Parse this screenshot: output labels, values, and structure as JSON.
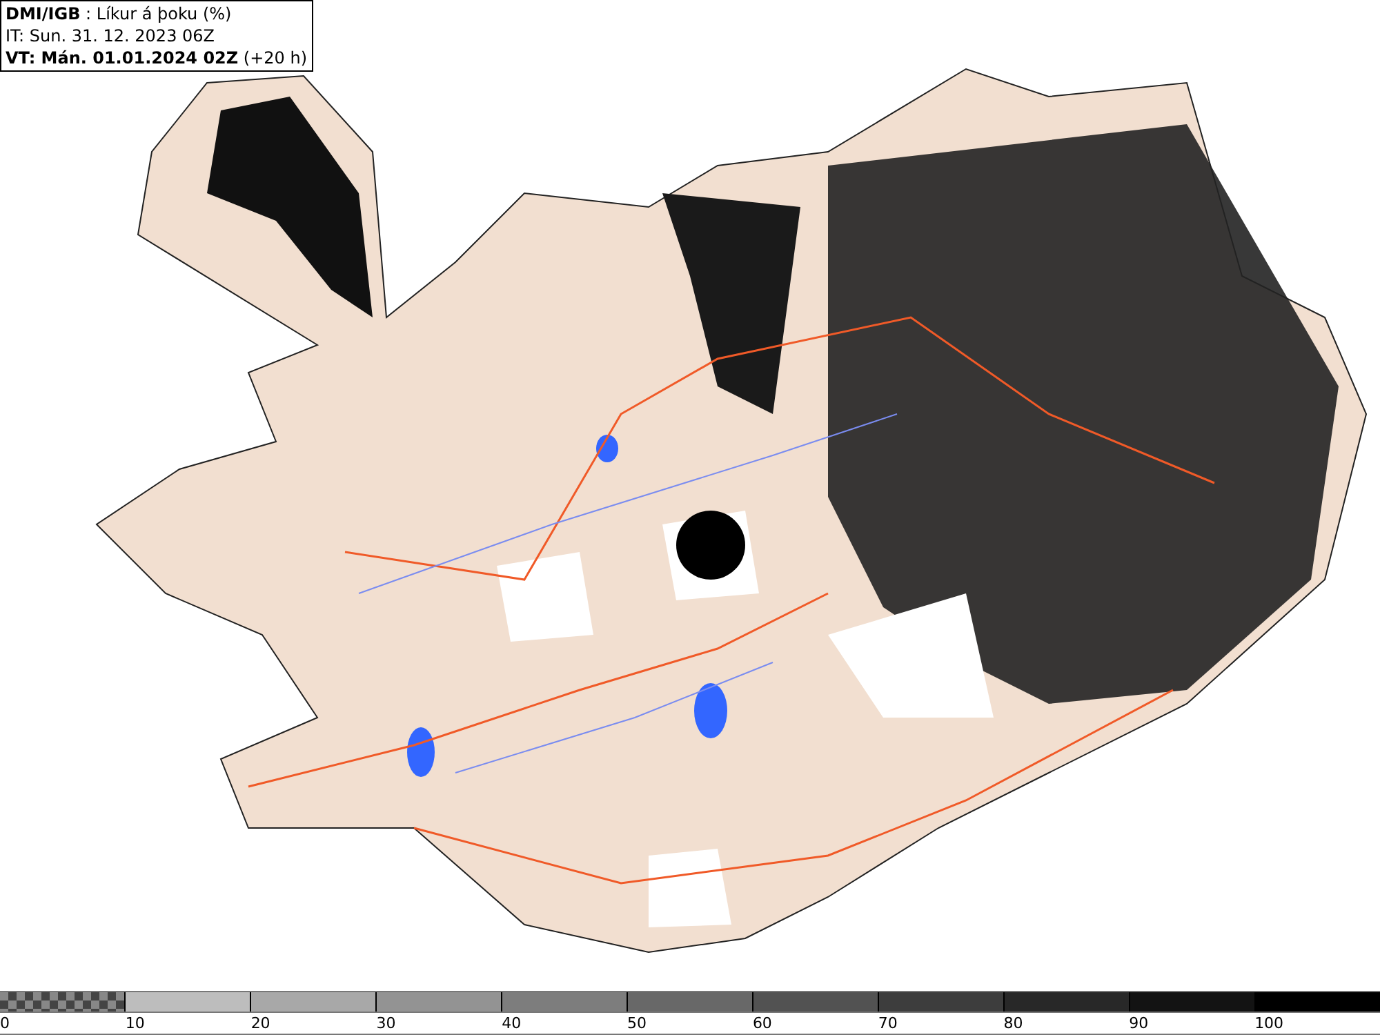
{
  "header": {
    "lines": [
      "**DMI/IGB** : Líkur á þoku (%)",
      "IT: Sun. 31. 12. 2023 06Z",
      "**VT: Mán. 01.01.2024 02Z** (+20 h)"
    ]
  },
  "legend": {
    "segments": [
      {
        "label": "0",
        "kind": "checker"
      },
      {
        "label": "10",
        "kind": "solid",
        "color": "#bdbdbd"
      },
      {
        "label": "20",
        "kind": "solid",
        "color": "#a8a8a8"
      },
      {
        "label": "30",
        "kind": "solid",
        "color": "#939393"
      },
      {
        "label": "40",
        "kind": "solid",
        "color": "#7d7d7d"
      },
      {
        "label": "50",
        "kind": "solid",
        "color": "#686868"
      },
      {
        "label": "60",
        "kind": "solid",
        "color": "#525252"
      },
      {
        "label": "70",
        "kind": "solid",
        "color": "#3d3d3d"
      },
      {
        "label": "80",
        "kind": "solid",
        "color": "#282828"
      },
      {
        "label": "90",
        "kind": "solid",
        "color": "#131313"
      },
      {
        "label": "100",
        "kind": "solid",
        "color": "#000000"
      }
    ]
  }
}
